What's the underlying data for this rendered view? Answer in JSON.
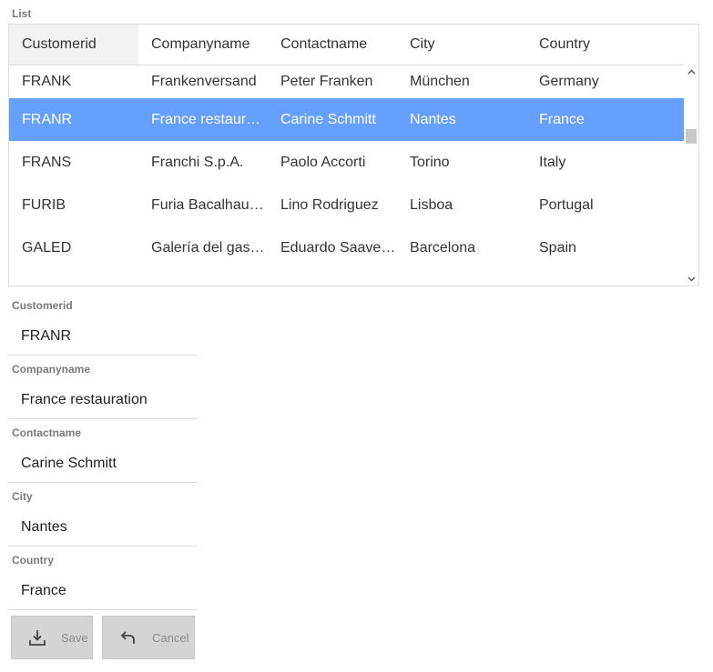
{
  "list": {
    "title": "List",
    "columns": [
      "Customerid",
      "Companyname",
      "Contactname",
      "City",
      "Country"
    ],
    "sorted_column": "Customerid",
    "rows": [
      [
        "FRANK",
        "Frankenversand",
        "Peter Franken",
        "München",
        "Germany"
      ],
      [
        "FRANR",
        "France restauration",
        "Carine Schmitt",
        "Nantes",
        "France"
      ],
      [
        "FRANS",
        "Franchi S.p.A.",
        "Paolo Accorti",
        "Torino",
        "Italy"
      ],
      [
        "FURIB",
        "Furia Bacalhau e …",
        "Lino Rodriguez",
        "Lisboa",
        "Portugal"
      ],
      [
        "GALED",
        "Galería del gastró…",
        "Eduardo Saavedra",
        "Barcelona",
        "Spain"
      ]
    ],
    "selected_row_index": 1,
    "selected_color": "#66a0ff"
  },
  "form": {
    "fields": [
      {
        "label": "Customerid",
        "value": "FRANR"
      },
      {
        "label": "Companyname",
        "value": "France restauration"
      },
      {
        "label": "Contactname",
        "value": "Carine Schmitt"
      },
      {
        "label": "City",
        "value": "Nantes"
      },
      {
        "label": "Country",
        "value": "France"
      }
    ]
  },
  "buttons": {
    "save_label": "Save",
    "save_icon": "save-download-icon",
    "cancel_label": "Cancel",
    "cancel_icon": "undo-arrow-icon"
  }
}
